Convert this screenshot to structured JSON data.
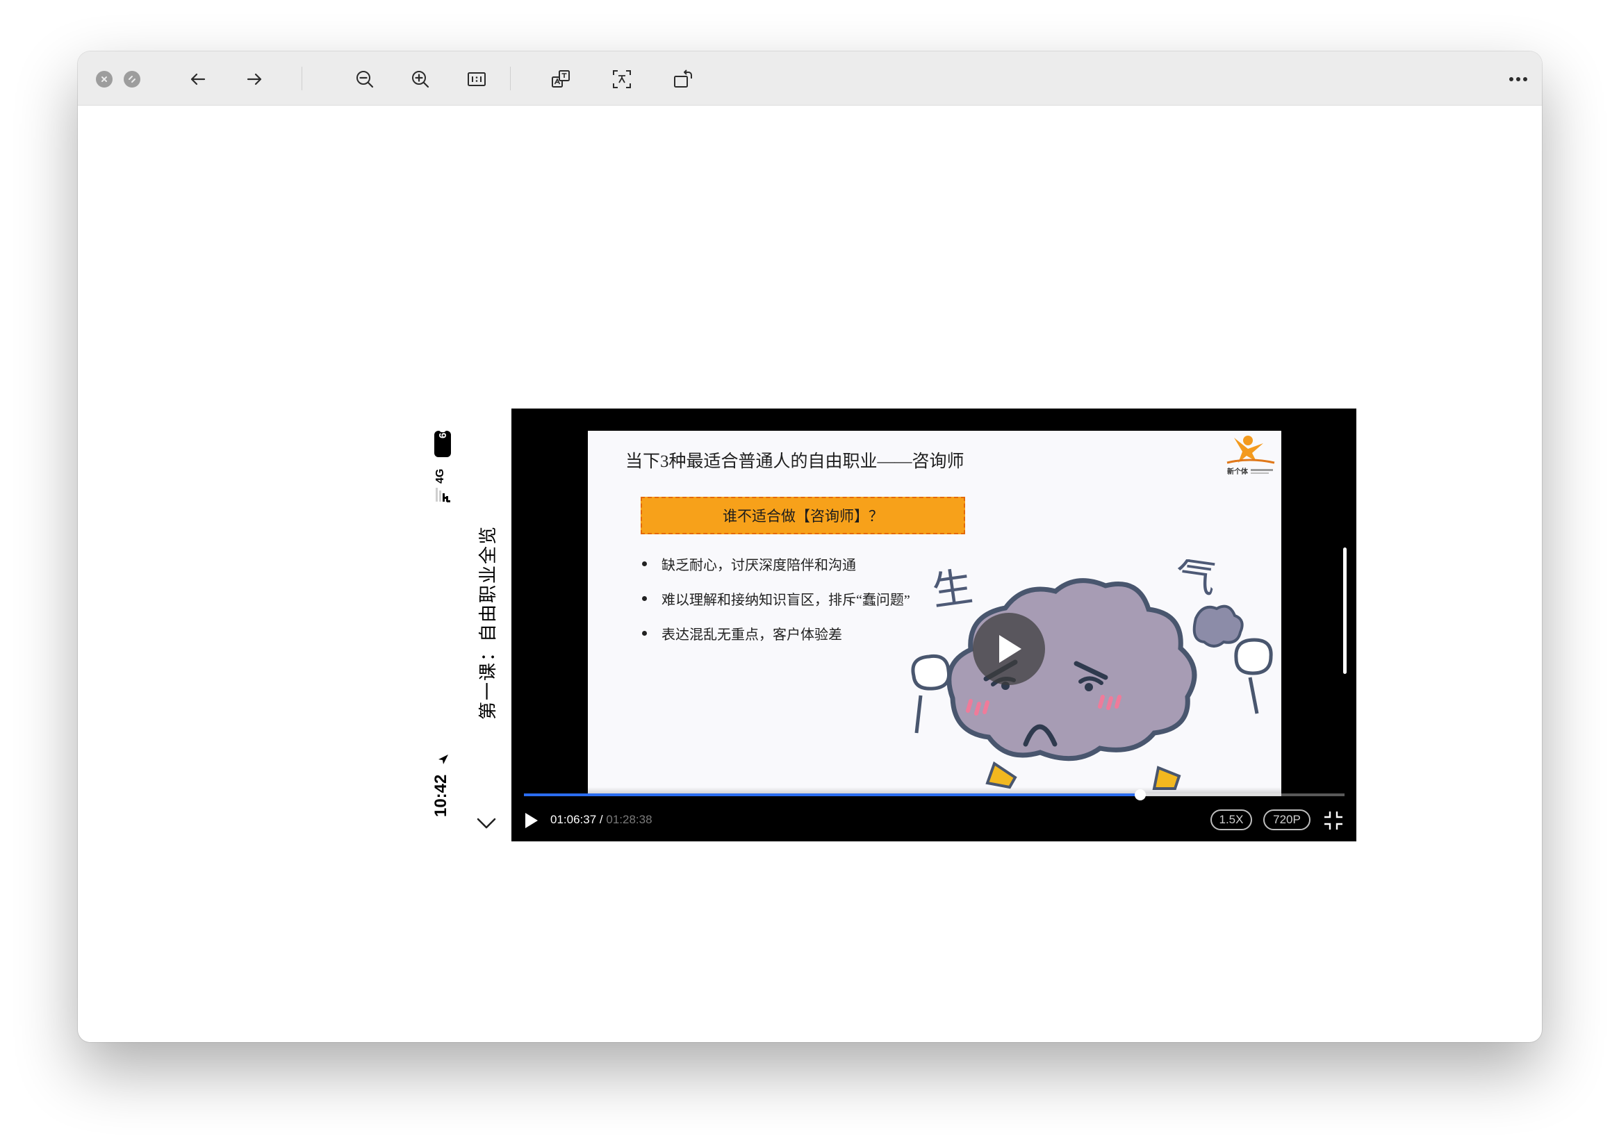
{
  "window": {
    "toolbar": {
      "close_icon": "close-icon",
      "fullscreen_icon": "fullscreen-icon",
      "back_icon": "arrow-left-icon",
      "forward_icon": "arrow-right-icon",
      "zoom_out_icon": "zoom-out-icon",
      "zoom_in_icon": "zoom-in-icon",
      "actual_size_label": "1:1",
      "translate_icon": "translate-icon",
      "ocr_icon": "text-recognition-icon",
      "rotate_icon": "rotate-icon",
      "more_icon": "more-icon"
    }
  },
  "phone": {
    "time": "10:42",
    "network": "4G",
    "battery": "66",
    "course_title": "第一课：自由职业全览"
  },
  "slide": {
    "title": "当下3种最适合普通人的自由职业——咨询师",
    "banner": "谁不适合做【咨询师】？",
    "bullets": [
      "缺乏耐心，讨厌深度陪伴和沟通",
      "难以理解和接纳知识盲区，排斥“蠢问题”",
      "表达混乱无重点，客户体验差"
    ],
    "art_text_left": "生",
    "art_text_right": "气",
    "logo_text": "新个体"
  },
  "player": {
    "current_time": "01:06:37",
    "separator": " / ",
    "total_time": "01:28:38",
    "progress_fraction": 0.751,
    "speed_label": "1.5X",
    "quality_label": "720P",
    "accent_color": "#2b6df0"
  }
}
